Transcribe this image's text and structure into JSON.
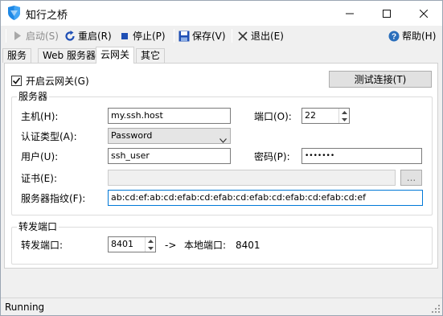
{
  "window": {
    "title": "知行之桥"
  },
  "toolbar": {
    "start_label": "启动(S)",
    "restart_label": "重启(R)",
    "stop_label": "停止(P)",
    "save_label": "保存(V)",
    "exit_label": "退出(E)",
    "help_label": "帮助(H)"
  },
  "tabs": [
    {
      "label": "服务"
    },
    {
      "label": "Web 服务器"
    },
    {
      "label": "云网关"
    },
    {
      "label": "其它"
    }
  ],
  "gateway": {
    "enable_label": "开启云网关(G)",
    "enabled": true,
    "test_button": "测试连接(T)"
  },
  "server": {
    "group_label": "服务器",
    "host_label": "主机(H):",
    "host_value": "my.ssh.host",
    "port_label": "端口(O):",
    "port_value": "22",
    "auth_label": "认证类型(A):",
    "auth_value": "Password",
    "user_label": "用户(U):",
    "user_value": "ssh_user",
    "password_label": "密码(P):",
    "password_value": "•••••••",
    "cert_label": "证书(E):",
    "cert_value": "",
    "browse_label": "...",
    "fingerprint_label": "服务器指纹(F):",
    "fingerprint_value": "ab:cd:ef:ab:cd:efab:cd:efab:cd:efab:cd:efab:cd:efab:cd:ef"
  },
  "forward": {
    "group_label": "转发端口",
    "port_label": "转发端口:",
    "port_value": "8401",
    "arrow": "->",
    "local_label": "本地端口:",
    "local_value": "8401"
  },
  "status": {
    "text": "Running"
  },
  "colors": {
    "accent_blue": "#1e6fd9",
    "focus_border": "#0078d7",
    "help_icon": "#2a6ebb",
    "stop_icon": "#1f4fb5"
  }
}
